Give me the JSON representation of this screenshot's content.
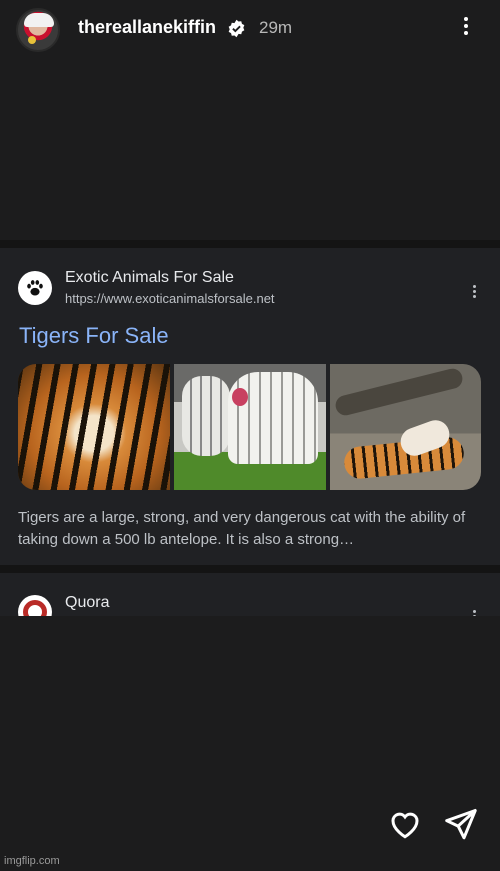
{
  "story": {
    "username": "thereallanekiffin",
    "timestamp": "29m",
    "verified_icon": "verified-badge-icon",
    "menu_icon": "more-vertical-icon"
  },
  "result": {
    "site_name": "Exotic Animals For Sale",
    "site_url": "https://www.exoticanimalsforsale.net",
    "site_icon": "paw-print-icon",
    "title": "Tigers For Sale",
    "images": [
      "tiger-face-image",
      "white-tiger-cubs-image",
      "tiger-lying-on-back-image"
    ],
    "snippet": "Tigers are a large, strong, and very dangerous cat with the ability of taking down a 500 lb antelope. It is also a strong…"
  },
  "next_result": {
    "site_name": "Quora",
    "site_icon": "quora-logo-icon"
  },
  "actions": {
    "like_icon": "heart-icon",
    "share_icon": "send-icon"
  },
  "watermark": "imgflip.com",
  "colors": {
    "background": "#1c1c1d",
    "card": "#202124",
    "link_blue": "#8ab4f8",
    "snippet_gray": "#bdc1c6"
  }
}
